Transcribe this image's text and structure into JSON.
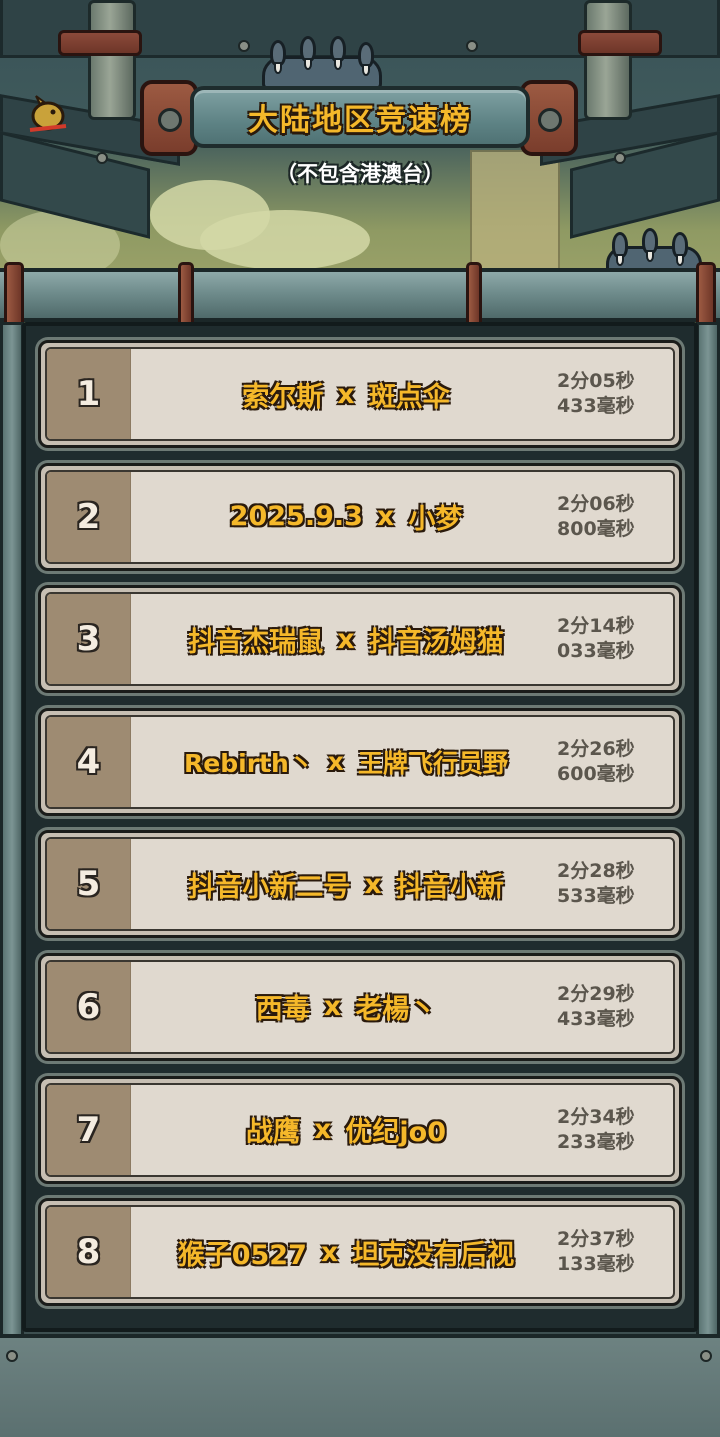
{
  "header": {
    "title": "大陆地区竞速榜",
    "subtitle": "（不包含港澳台）"
  },
  "ranking": {
    "separator": "x",
    "rows": [
      {
        "rank": "1",
        "player1": "索尔斯",
        "player2": "斑点伞",
        "time_min": "2分05秒",
        "time_ms": "433毫秒"
      },
      {
        "rank": "2",
        "player1": "2025.9.3",
        "player2": "小梦",
        "time_min": "2分06秒",
        "time_ms": "800毫秒"
      },
      {
        "rank": "3",
        "player1": "抖音杰瑞鼠",
        "player2": "抖音汤姆猫",
        "time_min": "2分14秒",
        "time_ms": "033毫秒"
      },
      {
        "rank": "4",
        "player1": "Rebirth丶",
        "player2": "王牌飞行员野",
        "time_min": "2分26秒",
        "time_ms": "600毫秒"
      },
      {
        "rank": "5",
        "player1": "抖音小新二号",
        "player2": "抖音小新",
        "time_min": "2分28秒",
        "time_ms": "533毫秒"
      },
      {
        "rank": "6",
        "player1": "西毒",
        "player2": "老楊丶",
        "time_min": "2分29秒",
        "time_ms": "433毫秒"
      },
      {
        "rank": "7",
        "player1": "战鹰",
        "player2": "优纪jo0",
        "time_min": "2分34秒",
        "time_ms": "233毫秒"
      },
      {
        "rank": "8",
        "player1": "猴子0527",
        "player2": "坦克没有后视",
        "time_min": "2分37秒",
        "time_ms": "133毫秒"
      }
    ]
  },
  "colors": {
    "name_text": "#f5b82a",
    "time_text": "#5b564d",
    "rank_box": "#9e8b72",
    "row_bg": "#e0d9cf"
  },
  "icons": {
    "monster_claws": "claw-icon",
    "bird": "bird-icon"
  }
}
